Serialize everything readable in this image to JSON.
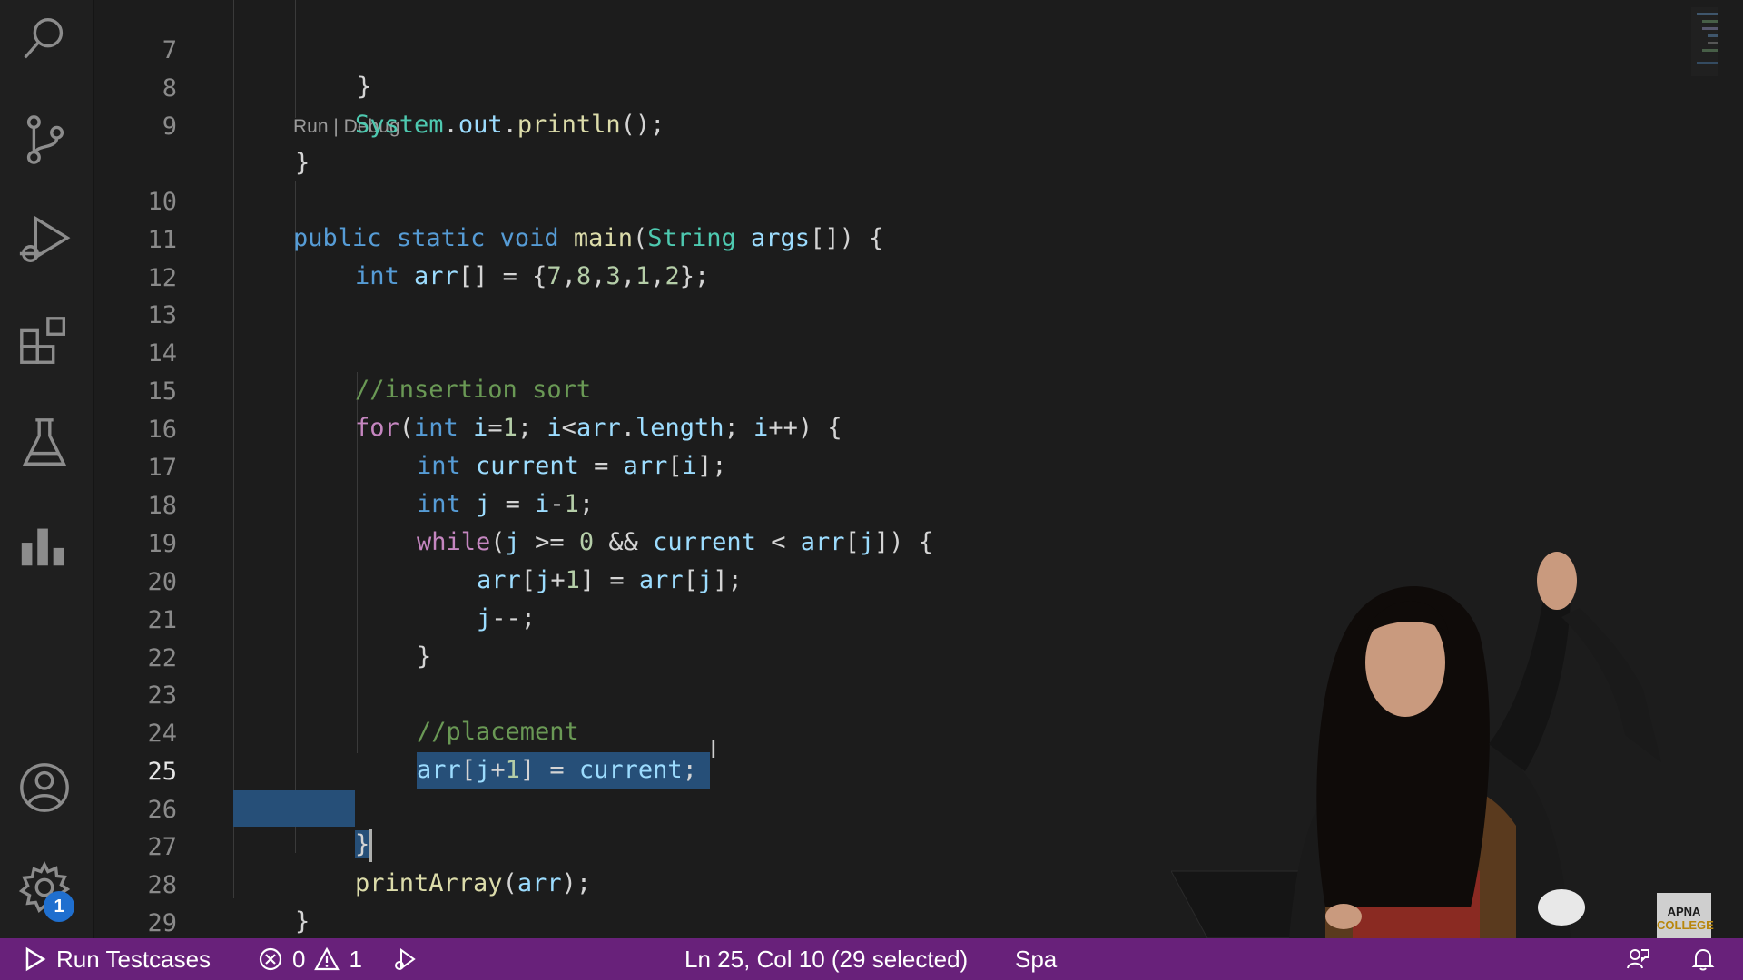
{
  "editor": {
    "codelens": "Run | Debug",
    "lines": [
      {
        "n": "7"
      },
      {
        "n": "8"
      },
      {
        "n": "9"
      },
      {
        "n": "10"
      },
      {
        "n": "11"
      },
      {
        "n": "12"
      },
      {
        "n": "13"
      },
      {
        "n": "14"
      },
      {
        "n": "15"
      },
      {
        "n": "16"
      },
      {
        "n": "17"
      },
      {
        "n": "18"
      },
      {
        "n": "19"
      },
      {
        "n": "20"
      },
      {
        "n": "21"
      },
      {
        "n": "22"
      },
      {
        "n": "23"
      },
      {
        "n": "24"
      },
      {
        "n": "25"
      },
      {
        "n": "26"
      },
      {
        "n": "27"
      },
      {
        "n": "28"
      },
      {
        "n": "29"
      }
    ],
    "tokens": {
      "l7_brace": "}",
      "l8_system": "System",
      "l8_dot1": ".",
      "l8_out": "out",
      "l8_dot2": ".",
      "l8_println": "println",
      "l8_end": "();",
      "l9_brace": "}",
      "l10_public": "public",
      "l10_static": "static",
      "l10_void": "void",
      "l10_main": "main",
      "l10_paren": "(",
      "l10_string": "String",
      "l10_args": "args",
      "l10_end": "[]) {",
      "l11_int": "int",
      "l11_arr": "arr",
      "l11_mid": "[] = {",
      "l11_n1": "7",
      "l11_c1": ",",
      "l11_n2": "8",
      "l11_c2": ",",
      "l11_n3": "3",
      "l11_c3": ",",
      "l11_n4": "1",
      "l11_c4": ",",
      "l11_n5": "2",
      "l11_end": "};",
      "l14_comment": "//insertion sort",
      "l15_for": "for",
      "l15_p": "(",
      "l15_int": "int",
      "l15_i": "i",
      "l15_eq": "=",
      "l15_one": "1",
      "l15_semi": "; ",
      "l15_i2": "i",
      "l15_lt": "<",
      "l15_arr": "arr",
      "l15_dot": ".",
      "l15_length": "length",
      "l15_semi2": "; ",
      "l15_i3": "i",
      "l15_end": "++) {",
      "l16_int": "int",
      "l16_current": "current",
      "l16_eq": " = ",
      "l16_arr": "arr",
      "l16_b1": "[",
      "l16_i": "i",
      "l16_end": "];",
      "l17_int": "int",
      "l17_j": "j",
      "l17_eq": " = ",
      "l17_i": "i",
      "l17_minus": "-",
      "l17_one": "1",
      "l17_end": ";",
      "l18_while": "while",
      "l18_p": "(",
      "l18_j": "j",
      "l18_ge": " >= ",
      "l18_zero": "0",
      "l18_and": " && ",
      "l18_current": "current",
      "l18_lt": " < ",
      "l18_arr": "arr",
      "l18_b1": "[",
      "l18_j2": "j",
      "l18_end": "]) {",
      "l19_arr": "arr",
      "l19_b1": "[",
      "l19_j": "j",
      "l19_plus": "+",
      "l19_one": "1",
      "l19_mid": "] = ",
      "l19_arr2": "arr",
      "l19_b2": "[",
      "l19_j2": "j",
      "l19_end": "];",
      "l20_j": "j",
      "l20_end": "--;",
      "l21_brace": "}",
      "l23_comment": "//placement",
      "l24_arr": "arr",
      "l24_b1": "[",
      "l24_j": "j",
      "l24_plus": "+",
      "l24_one": "1",
      "l24_mid": "] = ",
      "l24_current": "current",
      "l24_end": ";",
      "l25_brace": "}",
      "l27_fn": "printArray",
      "l27_p": "(",
      "l27_arr": "arr",
      "l27_end": ");",
      "l28_brace": "}",
      "l29_brace": "}"
    }
  },
  "activity_bar": {
    "icons": [
      "search-icon",
      "source-control-icon",
      "run-debug-icon",
      "extensions-icon",
      "testing-icon",
      "chart-icon",
      "account-icon",
      "settings-gear-icon"
    ],
    "settings_badge": "1"
  },
  "statusbar": {
    "run_testcases": "Run Testcases",
    "errors": "0",
    "warnings": "1",
    "position": "Ln 25, Col 10 (29 selected)",
    "spaces_partial": "Spa",
    "bg_color": "#68217a"
  },
  "watermark": {
    "line1": "APNA",
    "line2": "COLLEGE"
  }
}
